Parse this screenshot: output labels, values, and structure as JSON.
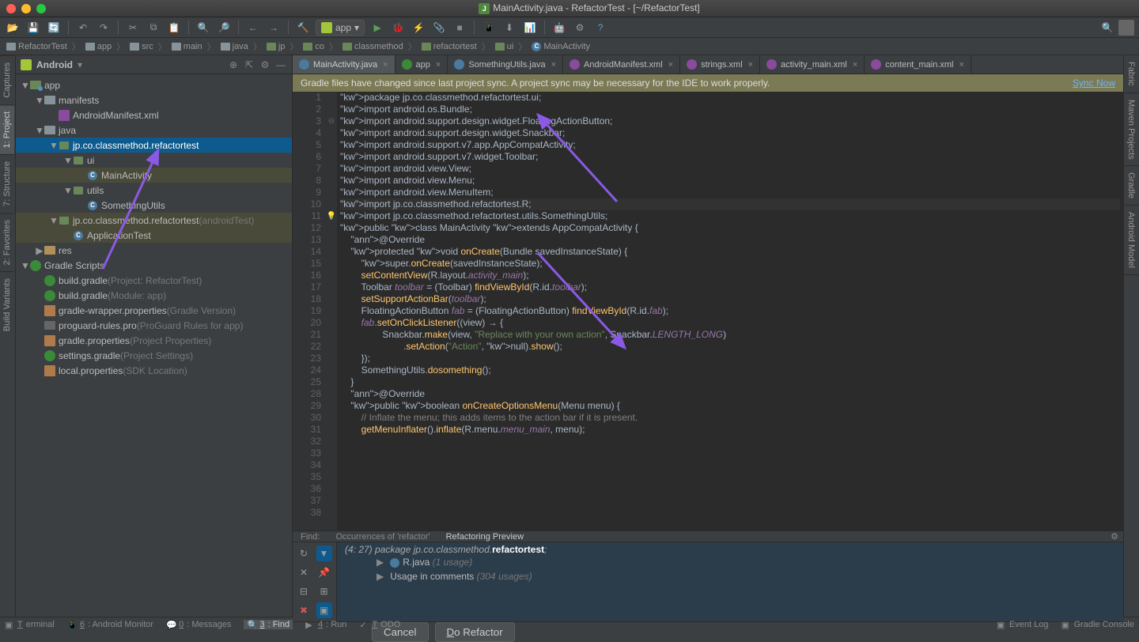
{
  "window": {
    "title": "MainActivity.java - RefactorTest - [~/RefactorTest]"
  },
  "runConfig": {
    "label": "app"
  },
  "breadcrumb": [
    {
      "label": "RefactorTest",
      "type": "proj"
    },
    {
      "label": "app",
      "type": "mod"
    },
    {
      "label": "src",
      "type": "dir"
    },
    {
      "label": "main",
      "type": "dir"
    },
    {
      "label": "java",
      "type": "java"
    },
    {
      "label": "jp",
      "type": "pkg"
    },
    {
      "label": "co",
      "type": "pkg"
    },
    {
      "label": "classmethod",
      "type": "pkg"
    },
    {
      "label": "refactortest",
      "type": "pkg"
    },
    {
      "label": "ui",
      "type": "pkg"
    },
    {
      "label": "MainActivity",
      "type": "cls"
    }
  ],
  "projectView": {
    "title": "Android",
    "tree": [
      {
        "d": 0,
        "exp": "▼",
        "icon": "mod",
        "label": "app"
      },
      {
        "d": 1,
        "exp": "▼",
        "icon": "folder",
        "label": "manifests"
      },
      {
        "d": 2,
        "exp": "",
        "icon": "xml",
        "label": "AndroidManifest.xml"
      },
      {
        "d": 1,
        "exp": "▼",
        "icon": "folder",
        "label": "java"
      },
      {
        "d": 2,
        "exp": "▼",
        "icon": "pkg",
        "label": "jp.co.classmethod.refactortest",
        "sel": true
      },
      {
        "d": 3,
        "exp": "▼",
        "icon": "pkg",
        "label": "ui"
      },
      {
        "d": 4,
        "exp": "",
        "icon": "cls",
        "label": "MainActivity",
        "hl": true
      },
      {
        "d": 3,
        "exp": "▼",
        "icon": "pkg",
        "label": "utils"
      },
      {
        "d": 4,
        "exp": "",
        "icon": "cls",
        "label": "SomethingUtils"
      },
      {
        "d": 2,
        "exp": "▼",
        "icon": "pkg",
        "label": "jp.co.classmethod.refactortest",
        "suffix": "(androidTest)",
        "hl": true
      },
      {
        "d": 3,
        "exp": "",
        "icon": "cls",
        "label": "ApplicationTest",
        "hl": true
      },
      {
        "d": 1,
        "exp": "▶",
        "icon": "res",
        "label": "res"
      },
      {
        "d": 0,
        "exp": "▼",
        "icon": "gradle",
        "label": "Gradle Scripts"
      },
      {
        "d": 1,
        "exp": "",
        "icon": "gradle",
        "label": "build.gradle",
        "suffix": "(Project: RefactorTest)"
      },
      {
        "d": 1,
        "exp": "",
        "icon": "gradle",
        "label": "build.gradle",
        "suffix": "(Module: app)"
      },
      {
        "d": 1,
        "exp": "",
        "icon": "prop",
        "label": "gradle-wrapper.properties",
        "suffix": "(Gradle Version)"
      },
      {
        "d": 1,
        "exp": "",
        "icon": "txt",
        "label": "proguard-rules.pro",
        "suffix": "(ProGuard Rules for app)"
      },
      {
        "d": 1,
        "exp": "",
        "icon": "prop",
        "label": "gradle.properties",
        "suffix": "(Project Properties)"
      },
      {
        "d": 1,
        "exp": "",
        "icon": "gradle",
        "label": "settings.gradle",
        "suffix": "(Project Settings)"
      },
      {
        "d": 1,
        "exp": "",
        "icon": "prop",
        "label": "local.properties",
        "suffix": "(SDK Location)"
      }
    ]
  },
  "editorTabs": [
    {
      "label": "MainActivity.java",
      "icon": "java",
      "active": true
    },
    {
      "label": "app",
      "icon": "gradle"
    },
    {
      "label": "SomethingUtils.java",
      "icon": "java"
    },
    {
      "label": "AndroidManifest.xml",
      "icon": "xml"
    },
    {
      "label": "strings.xml",
      "icon": "xml"
    },
    {
      "label": "activity_main.xml",
      "icon": "xml"
    },
    {
      "label": "content_main.xml",
      "icon": "xml"
    }
  ],
  "syncBar": {
    "msg": "Gradle files have changed since last project sync. A project sync may be necessary for the IDE to work properly.",
    "action": "Sync Now"
  },
  "code": {
    "lines": [
      "package jp.co.classmethod.refactortest.ui;",
      "",
      "import android.os.Bundle;",
      "import android.support.design.widget.FloatingActionButton;",
      "import android.support.design.widget.Snackbar;",
      "import android.support.v7.app.AppCompatActivity;",
      "import android.support.v7.widget.Toolbar;",
      "import android.view.View;",
      "import android.view.Menu;",
      "import android.view.MenuItem;",
      "",
      "import jp.co.classmethod.refactortest.R;",
      "import jp.co.classmethod.refactortest.utils.SomethingUtils;",
      "",
      "public class MainActivity extends AppCompatActivity {",
      "",
      "    @Override",
      "    protected void onCreate(Bundle savedInstanceState) {",
      "        super.onCreate(savedInstanceState);",
      "        setContentView(R.layout.activity_main);",
      "        Toolbar toolbar = (Toolbar) findViewById(R.id.toolbar);",
      "        setSupportActionBar(toolbar);",
      "",
      "        FloatingActionButton fab = (FloatingActionButton) findViewById(R.id.fab);",
      "        fab.setOnClickListener((view) → {",
      "",
      "                Snackbar.make(view, \"Replace with your own action\", Snackbar.LENGTH_LONG)",
      "                        .setAction(\"Action\", null).show();",
      "",
      "        });",
      "        SomethingUtils.dosomething();",
      "    }",
      "",
      "    @Override",
      "    public boolean onCreateOptionsMenu(Menu menu) {",
      "        // Inflate the menu; this adds items to the action bar if it is present.",
      "        getMenuInflater().inflate(R.menu.menu_main, menu);"
    ],
    "lineNumbers": [
      "1",
      "2",
      "3",
      "4",
      "5",
      "6",
      "7",
      "8",
      "9",
      "10",
      "11",
      "12",
      "13",
      "14",
      "15",
      "16",
      "17",
      "18",
      "19",
      "20",
      "21",
      "22",
      "23",
      "24",
      "25",
      "28",
      "29",
      "30",
      "31",
      "32",
      "33",
      "34",
      "35",
      "36",
      "37",
      "38"
    ],
    "currentLine": 12
  },
  "findPanel": {
    "tabs": [
      "Find:",
      "Occurrences of 'refactor'",
      "Refactoring Preview"
    ],
    "activeTab": 2,
    "header": {
      "pos": "(4: 27)",
      "pre": "package jp.co.classmethod.",
      "match": "refactortest",
      "post": ";"
    },
    "results": [
      {
        "exp": "▶",
        "icon": "cls",
        "label": "R.java",
        "suffix": "(1 usage)"
      },
      {
        "exp": "▶",
        "icon": "",
        "label": "Usage in comments",
        "suffix": "(304 usages)"
      }
    ],
    "buttons": {
      "cancel": "Cancel",
      "do": "Do Refactor"
    }
  },
  "leftTabs": [
    "Captures",
    "1: Project",
    "7: Structure",
    "2: Favorites",
    "Build Variants"
  ],
  "rightTabs": [
    "Fabric",
    "Maven Projects",
    "Gradle",
    "Android Model"
  ],
  "statusbar": {
    "left": [
      "Terminal",
      "6: Android Monitor",
      "0: Messages",
      "3: Find",
      "4: Run",
      "TODO"
    ],
    "activeLeft": 3,
    "right": [
      "Event Log",
      "Gradle Console"
    ]
  }
}
